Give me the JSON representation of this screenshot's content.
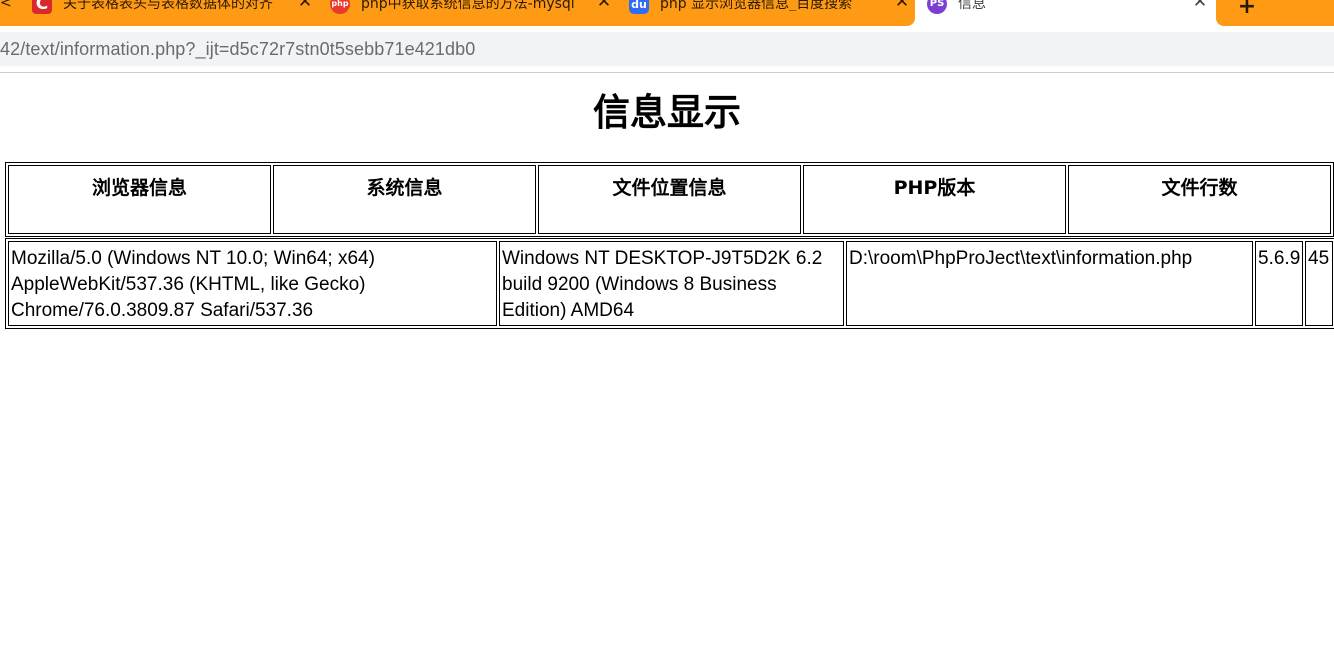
{
  "browser": {
    "tabs": [
      {
        "title": "",
        "icon": "chevron-left-icon"
      },
      {
        "title": "关于表格表头与表格数据体的对齐",
        "icon": "csdn-c-icon"
      },
      {
        "title": "php中获取系统信息的方法-mysql",
        "icon": "php-cn-icon"
      },
      {
        "title": "php 显示浏览器信息_百度搜索",
        "icon": "baidu-paw-icon"
      },
      {
        "title": "信息",
        "icon": "phpstorm-icon",
        "active": true
      }
    ],
    "new_tab_label": "+",
    "close_label": "✕",
    "url": "42/text/information.php?_ijt=d5c72r7stn0t5sebb71e421db0",
    "accent_color": "#ff9a14"
  },
  "page": {
    "title": "信息显示",
    "headers": [
      "浏览器信息",
      "系统信息",
      "文件位置信息",
      "PHP版本",
      "文件行数"
    ],
    "row": {
      "browser_info": "Mozilla/5.0 (Windows NT 10.0; Win64; x64) AppleWebKit/537.36 (KHTML, like Gecko) Chrome/76.0.3809.87 Safari/537.36",
      "system_info": "Windows NT DESKTOP-J9T5D2K 6.2 build 9200 (Windows 8 Business Edition) AMD64",
      "file_location": "D:\\room\\PhpProJect\\text\\information.php",
      "php_version": "5.6.9",
      "line_count": "45"
    }
  }
}
